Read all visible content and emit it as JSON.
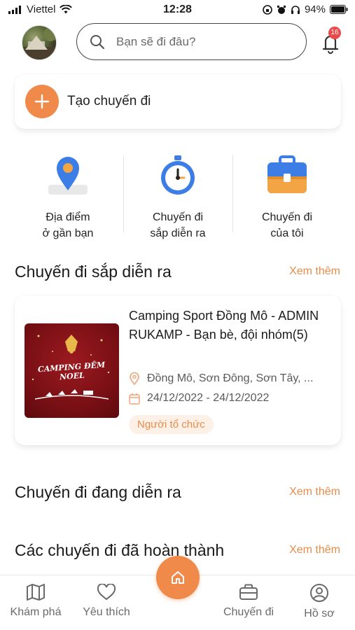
{
  "status_bar": {
    "carrier": "Viettel",
    "time": "12:28",
    "battery": "94%"
  },
  "header": {
    "search_placeholder": "Bạn sẽ đi đâu?",
    "notification_count": "16"
  },
  "create_trip": {
    "label": "Tạo chuyến đi"
  },
  "quick_actions": [
    {
      "line1": "Địa điểm",
      "line2": "ở gần bạn",
      "icon": "map-pin-icon"
    },
    {
      "line1": "Chuyến đi",
      "line2": "sắp diễn ra",
      "icon": "stopwatch-icon"
    },
    {
      "line1": "Chuyến đi",
      "line2": "của tôi",
      "icon": "briefcase-icon"
    }
  ],
  "sections": {
    "upcoming": {
      "title": "Chuyến đi sắp diễn ra",
      "more": "Xem thêm"
    },
    "ongoing": {
      "title": "Chuyến đi đang diễn ra",
      "more": "Xem thêm"
    },
    "completed": {
      "title": "Các chuyến đi đã hoàn thành",
      "more": "Xem thêm"
    }
  },
  "upcoming_trip": {
    "title": "Camping Sport Đồng Mô - ADMIN RUKAMP - Bạn bè, đội nhóm(5)",
    "location": "Đồng Mô, Sơn Đông, Sơn Tây, ...",
    "dates": "24/12/2022 - 24/12/2022",
    "role": "Người tổ chức",
    "thumbnail_text": "CAMPING ĐÊM NOEL"
  },
  "bottom_nav": {
    "explore": "Khám phá",
    "favorites": "Yêu thích",
    "trips": "Chuyến đi",
    "profile": "Hồ sơ"
  },
  "colors": {
    "accent": "#f08a4b",
    "link": "#e88c4a",
    "badge": "#e94b4b"
  }
}
